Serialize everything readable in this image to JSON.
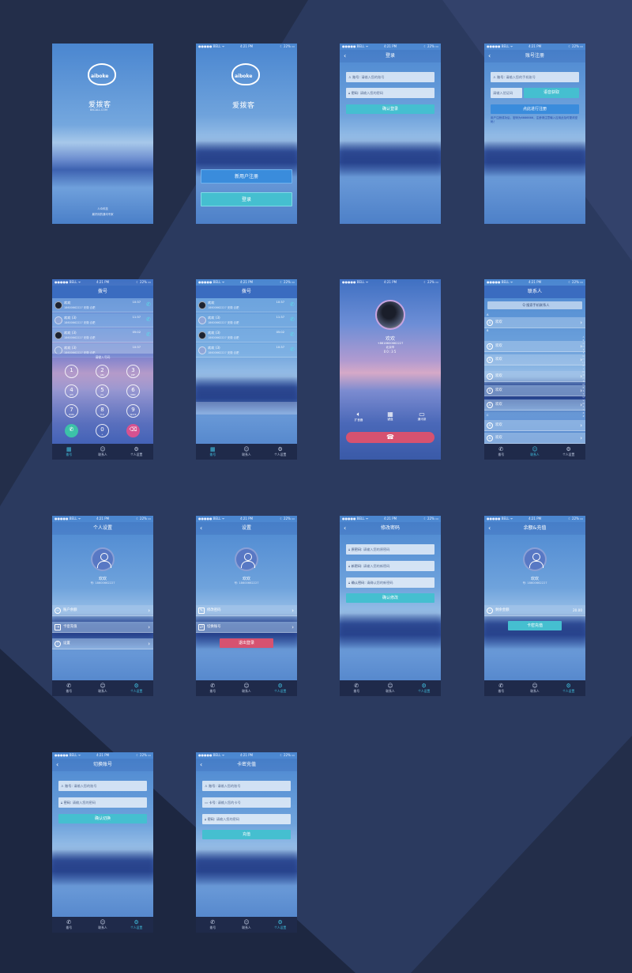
{
  "status": {
    "carrier": "●●●●● BELL ᯤ",
    "time": "4:21 PM",
    "battery": "☾ 22% ▭"
  },
  "splash": {
    "logo_text": "aiboke",
    "brand": "爱拨客",
    "site": "BKCALL.COM",
    "footer1": "人众科技",
    "footer2": "最好用的通讯专家"
  },
  "welcome": {
    "logo_text": "aiboke",
    "brand": "爱拨客",
    "register": "新用户注册",
    "login": "登录"
  },
  "login": {
    "title": "登录",
    "account_label": "账号:",
    "account_ph": "请输入您的账号",
    "password_label": "密码:",
    "password_ph": "请输入您的密码",
    "submit": "确认登录"
  },
  "register": {
    "title": "账号注册",
    "account_label": "账号:",
    "account_ph": "请输入您的手机账号",
    "code_ph": "请输入验证码",
    "code_btn": "语音获取",
    "submit": "点此进行注册",
    "note": "用户注册成功后，密码为6666666，注册请注意输入应用此及时更改密码！"
  },
  "dial": {
    "title": "拨号",
    "entries": [
      {
        "name": "欢欢",
        "number": "18600662227 安徽 合肥",
        "time": "10:37"
      },
      {
        "name": "欢欢 (3)",
        "number": "18600662227 安徽 合肥",
        "time": "11:37"
      },
      {
        "name": "欢欢 (3)",
        "number": "18600662227 安徽 合肥",
        "time": "05:02"
      },
      {
        "name": "欢欢 (3)",
        "number": "18600662227 安徽 合肥",
        "time": "10:37"
      }
    ],
    "input_ph": "请输入号码",
    "keys": [
      {
        "d": "1",
        "s": ""
      },
      {
        "d": "2",
        "s": "ABC"
      },
      {
        "d": "3",
        "s": "DEF"
      },
      {
        "d": "4",
        "s": "GHI"
      },
      {
        "d": "5",
        "s": "JKL"
      },
      {
        "d": "6",
        "s": "MNO"
      },
      {
        "d": "7",
        "s": "PQRS"
      },
      {
        "d": "8",
        "s": "TUV"
      },
      {
        "d": "9",
        "s": "WXYZ"
      },
      {
        "d": "✆",
        "s": ""
      },
      {
        "d": "0",
        "s": "+"
      },
      {
        "d": "⌫",
        "s": ""
      }
    ]
  },
  "call": {
    "name": "欢欢",
    "number": "+8618600662227",
    "location": "北京市",
    "duration": "00:35",
    "speaker": "扩音器",
    "keypad": "键盘",
    "contacts": "通讯录"
  },
  "contacts": {
    "title": "联系人",
    "search_ph": "Q 搜索手机联系人",
    "names": [
      "欢欢",
      "欢欢",
      "欢欢",
      "欢欢",
      "欢欢",
      "欢欢",
      "欢欢",
      "欢欢"
    ],
    "index": "A B C D E F G H I J K L M N O P Q R S T U V W X Y Z #"
  },
  "profile": {
    "title": "个人设置",
    "name": "欢欢",
    "number": "号: 18600662227",
    "items": [
      "账户余额",
      "卡密充值",
      "设置"
    ]
  },
  "settings": {
    "title": "设置",
    "name": "欢欢",
    "number": "号: 18600662227",
    "items": [
      "修改密码",
      "切换账号"
    ],
    "logout": "退出登录"
  },
  "change_pw": {
    "title": "修改密码",
    "fields": [
      {
        "l": "原密码:",
        "p": "请输入您的原密码"
      },
      {
        "l": "新密码:",
        "p": "请输入您的新密码"
      },
      {
        "l": "确认密码:",
        "p": "请确认您的新密码"
      }
    ],
    "submit": "确认修改"
  },
  "balance": {
    "title": "余额&充值",
    "name": "欢欢",
    "number": "号: 18600662227",
    "label": "剩余金额",
    "amount": "20.00",
    "recharge": "卡密充值"
  },
  "switch_acct": {
    "title": "切换账号",
    "account_label": "账号:",
    "account_ph": "请输入您的账号",
    "password_label": "密码:",
    "password_ph": "请输入您的密码",
    "submit": "确认切换"
  },
  "card": {
    "title": "卡密充值",
    "account_label": "账号:",
    "account_ph": "请输入您的账号",
    "card_label": "卡号:",
    "card_ph": "请输入您的卡号",
    "password_label": "密码:",
    "password_ph": "请输入您的密码",
    "submit": "充值"
  },
  "tabs": [
    "拨号",
    "联系人",
    "个人设置"
  ],
  "colors": {
    "accent": "#45bfd0",
    "danger": "#d65270",
    "tabbar": "#1f2a4a"
  }
}
